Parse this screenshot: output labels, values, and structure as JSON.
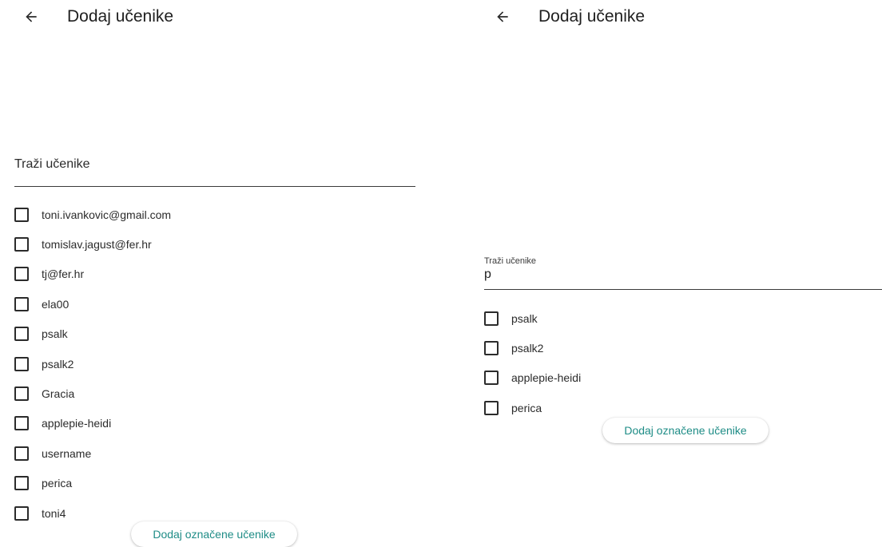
{
  "left": {
    "title": "Dodaj učenike",
    "search": {
      "placeholder": "Traži učenike",
      "value": ""
    },
    "items": [
      "toni.ivankovic@gmail.com",
      "tomislav.jagust@fer.hr",
      "tj@fer.hr",
      "ela00",
      "psalk",
      "psalk2",
      "Gracia",
      "applepie-heidi",
      "username",
      "perica",
      "toni4"
    ],
    "add_button_label": "Dodaj označene učenike"
  },
  "right": {
    "title": "Dodaj učenike",
    "search": {
      "label": "Traži učenike",
      "value": "p"
    },
    "items": [
      "psalk",
      "psalk2",
      "applepie-heidi",
      "perica"
    ],
    "add_button_label": "Dodaj označene učenike"
  },
  "icons": {
    "back": "arrow-back-icon",
    "checkbox": "checkbox-unchecked-icon"
  },
  "colors": {
    "accent": "#1e8c86",
    "text": "#1f1f1f"
  }
}
